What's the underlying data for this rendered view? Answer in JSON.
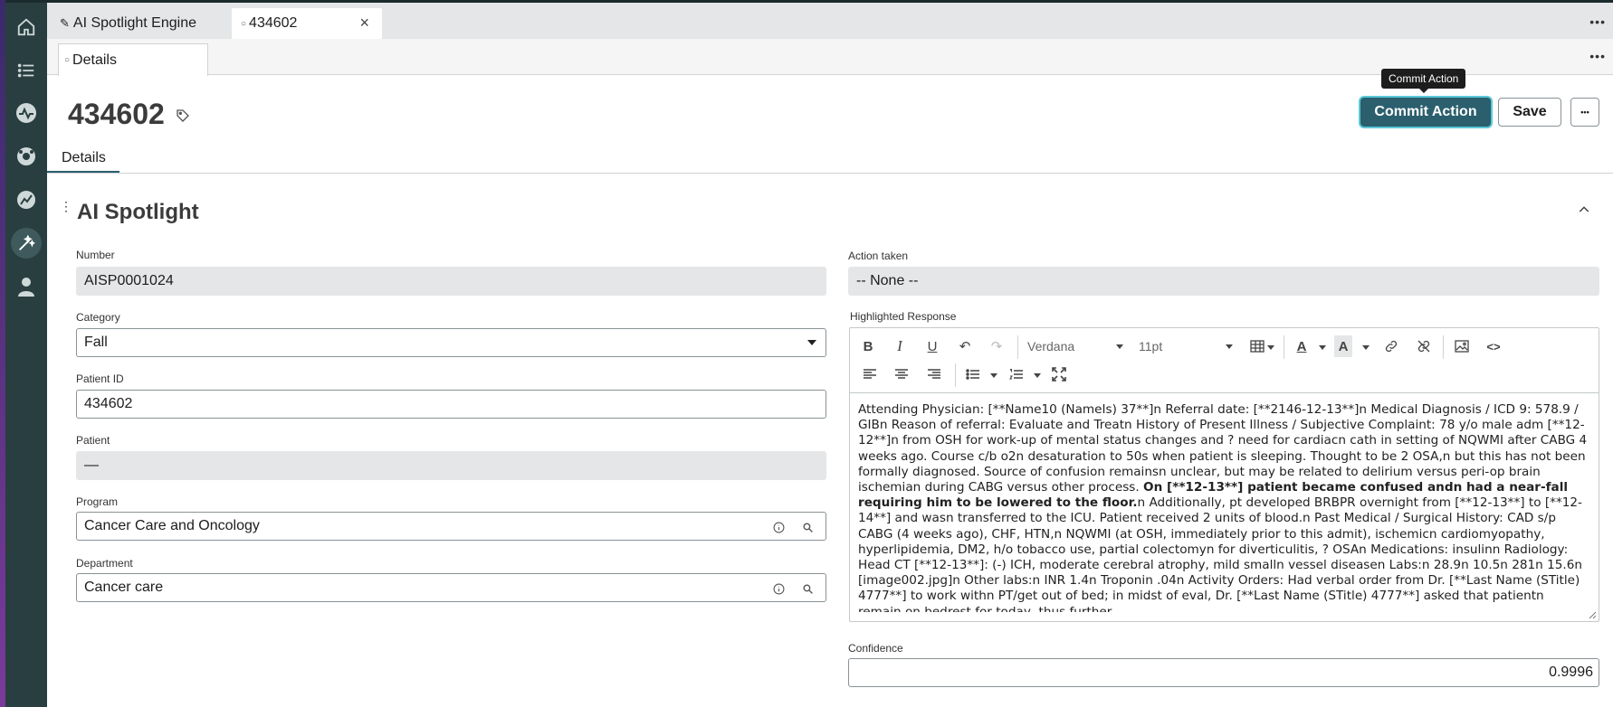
{
  "colors": {
    "rail": "#293e40",
    "primary": "#2b5f6e",
    "focus_ring": "#5ac8d8"
  },
  "rail": {
    "icons": [
      "home-icon",
      "list-icon",
      "activity-icon",
      "lifebuoy-icon",
      "dashboard-icon",
      "magic-wand-icon",
      "user-icon"
    ],
    "active": "magic-wand-icon"
  },
  "tabs": [
    {
      "label": "AI Spotlight Engine",
      "icon": "wand-icon"
    },
    {
      "label": "434602",
      "icon": "circle-icon",
      "close": "×"
    }
  ],
  "subtab": {
    "label": "Details"
  },
  "record": {
    "title": "434602"
  },
  "actions": {
    "commit": "Commit Action",
    "save": "Save",
    "more": "•••",
    "tooltip": "Commit Action"
  },
  "form_tab": "Details",
  "section": {
    "title": "AI Spotlight"
  },
  "fields": {
    "number": {
      "label": "Number",
      "value": "AISP0001024"
    },
    "category": {
      "label": "Category",
      "value": "Fall"
    },
    "patient_id": {
      "label": "Patient ID",
      "value": "434602"
    },
    "patient": {
      "label": "Patient",
      "value": "—"
    },
    "program": {
      "label": "Program",
      "value": "Cancer Care and Oncology"
    },
    "department": {
      "label": "Department",
      "value": "Cancer care"
    },
    "action_taken": {
      "label": "Action taken",
      "value": "-- None --"
    },
    "highlighted": {
      "label": "Highlighted Response"
    },
    "confidence": {
      "label": "Confidence",
      "value": "0.9996"
    }
  },
  "editor": {
    "font": "Verdana",
    "size": "11pt",
    "text_before": "Attending Physician: [**Name10 (NameIs) 37**]n Referral date: [**2146-12-13**]n Medical Diagnosis / ICD 9: 578.9 / GIBn Reason of referral: Evaluate and Treatn History of Present Illness / Subjective Complaint: 78 y/o male adm [**12-12**]n from OSH for work-up of mental status changes and ? need for cardiacn cath in setting of NQWMI after CABG 4 weeks ago. Course c/b o2n desaturation to 50s when patient is sleeping. Thought to be 2 OSA,n but this has not been formally diagnosed. Source of confusion remainsn unclear, but may be related to delirium versus peri-op brain ischemian during CABG versus other process. ",
    "text_bold": "On [**12-13**] patient became confused andn had a near-fall requiring him to be lowered to the floor.",
    "text_after": "n Additionally, pt developed BRBPR overnight from [**12-13**] to [**12-14**] and wasn transferred to the ICU. Patient received 2 units of blood.n Past Medical / Surgical History: CAD s/p CABG (4 weeks ago), CHF, HTN,n NQWMI (at OSH, immediately prior to this admit), ischemicn cardiomyopathy, hyperlipidemia, DM2, h/o tobacco use, partial colectomyn for diverticulitis, ? OSAn Medications: insulinn Radiology: Head CT [**12-13**]: (-) ICH, moderate cerebral atrophy, mild smalln vessel diseasen Labs:n 28.9n 10.5n 281n 15.6n [image002.jpg]n Other labs:n INR 1.4n Troponin .04n Activity Orders: Had verbal order from Dr. [**Last Name (STitle) 4777**] to work withn PT/get out of bed; in midst of eval, Dr. [**Last Name (STitle) 4777**] asked that patientn remain on bedrest for today, thus further"
  }
}
